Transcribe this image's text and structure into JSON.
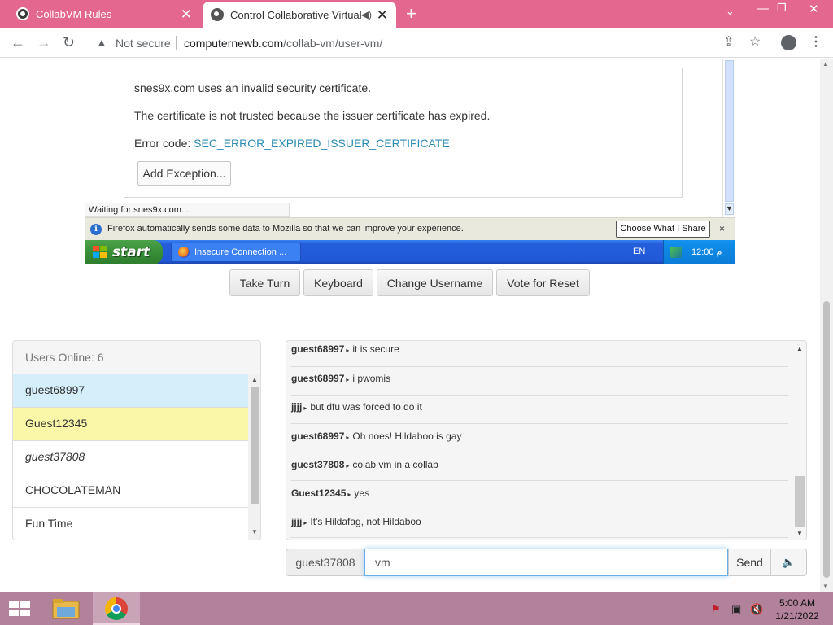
{
  "browser": {
    "tabs": [
      {
        "label": "CollabVM Rules",
        "active": false
      },
      {
        "label": "Control Collaborative Virtual",
        "active": true
      }
    ],
    "new_tab": "+",
    "address": {
      "security_label": "Not secure",
      "host": "computernewb.com",
      "path": "/collab-vm/user-vm/"
    }
  },
  "vm_screen": {
    "error_box": {
      "line1": "snes9x.com uses an invalid security certificate.",
      "line2": "The certificate is not trusted because the issuer certificate has expired.",
      "code_label": "Error code: ",
      "code": "SEC_ERROR_EXPIRED_ISSUER_CERTIFICATE",
      "button": "Add Exception..."
    },
    "status": "Waiting for snes9x.com...",
    "infobar": {
      "text": "Firefox automatically sends some data to Mozilla so that we can improve your experience.",
      "button": "Choose What I Share",
      "close": "×"
    },
    "taskbar": {
      "start": "start",
      "item": "Insecure Connection ...",
      "lang": "EN",
      "clock": "12:00 م"
    }
  },
  "vm_controls": [
    {
      "label": "Take Turn"
    },
    {
      "label": "Keyboard"
    },
    {
      "label": "Change Username"
    },
    {
      "label": "Vote for Reset"
    }
  ],
  "users": {
    "header": "Users Online: 6",
    "list": [
      {
        "name": "guest68997",
        "style": "me"
      },
      {
        "name": "Guest12345",
        "style": "admin"
      },
      {
        "name": "guest37808",
        "style": "guest"
      },
      {
        "name": "CHOCOLATEMAN",
        "style": ""
      },
      {
        "name": "Fun Time",
        "style": ""
      }
    ]
  },
  "chat": {
    "messages": [
      {
        "user": "guest68997",
        "text": "it is secure"
      },
      {
        "user": "guest68997",
        "text": "i pwomis"
      },
      {
        "user": "jjjj",
        "text": "but dfu was forced to do it"
      },
      {
        "user": "guest68997",
        "text": "Oh noes! Hildaboo is gay"
      },
      {
        "user": "guest37808",
        "text": "colab vm in a collab"
      },
      {
        "user": "Guest12345",
        "text": "yes"
      },
      {
        "user": "jjjj",
        "text": "It's Hildafag, not Hildaboo"
      }
    ],
    "input": {
      "username": "guest37808",
      "value": "vm",
      "send": "Send"
    }
  },
  "os_taskbar": {
    "time": "5:00 AM",
    "date": "1/21/2022"
  },
  "colors": {
    "tabstrip": "#e4678f",
    "taskbar": "#b18299",
    "me_row": "#d4eefa",
    "admin_row": "#fbf7a9"
  }
}
